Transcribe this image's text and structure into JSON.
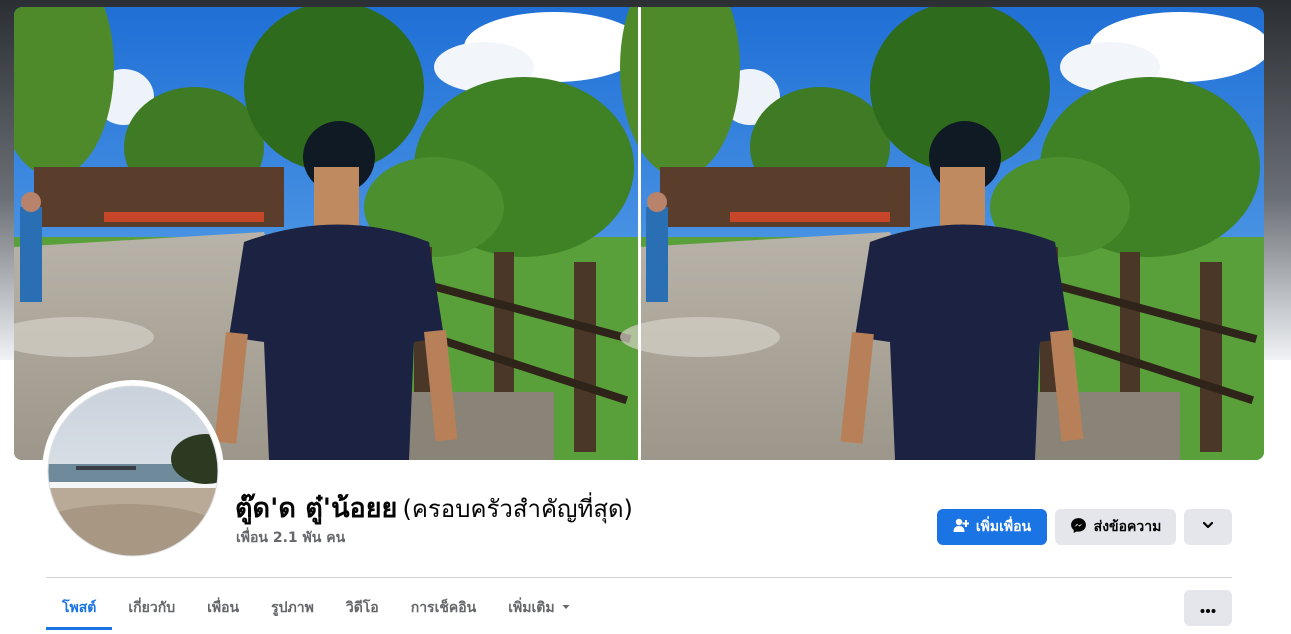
{
  "profile": {
    "name": "ตู๊ด'ด ตู๋'น้อยย",
    "alternate_name": "(ครอบครัวสำคัญที่สุด)",
    "friends_count": "เพื่อน 2.1 พัน คน"
  },
  "actions": {
    "add_friend_label": "เพิ่มเพื่อน",
    "message_label": "ส่งข้อความ",
    "more_icon": "chevron-down-icon",
    "options_icon": "ellipsis-icon"
  },
  "tabs": [
    {
      "label": "โพสต์",
      "active": true
    },
    {
      "label": "เกี่ยวกับ",
      "active": false
    },
    {
      "label": "เพื่อน",
      "active": false
    },
    {
      "label": "รูปภาพ",
      "active": false
    },
    {
      "label": "วิดีโอ",
      "active": false
    },
    {
      "label": "การเช็คอิน",
      "active": false
    },
    {
      "label": "เพิ่มเติม",
      "active": false
    }
  ],
  "colors": {
    "accent": "#1b74e4",
    "secondary_button": "#e4e6eb",
    "muted_text": "#65676b"
  }
}
